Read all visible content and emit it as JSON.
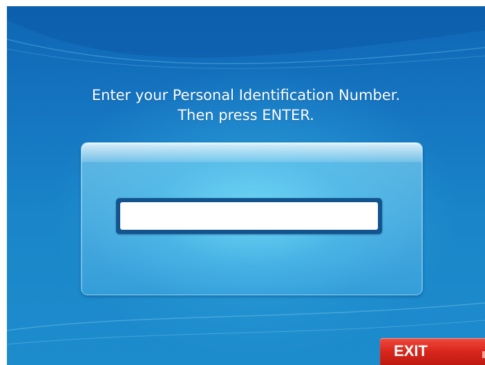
{
  "prompt": {
    "line1": "Enter your Personal Identification Number.",
    "line2": "Then press ENTER."
  },
  "pin_input": {
    "value": "",
    "placeholder": ""
  },
  "exit_button": {
    "label": "EXIT"
  },
  "colors": {
    "background_top": "#0f66b4",
    "background_bottom": "#1d8ccd",
    "panel": "#3aa6df",
    "field_border": "#14548e",
    "exit": "#d8261b"
  }
}
